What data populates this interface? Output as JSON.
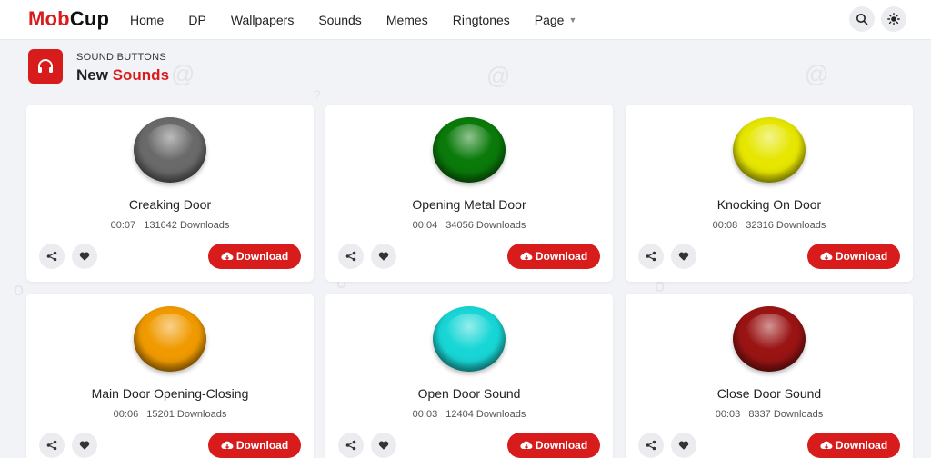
{
  "brand": {
    "part1": "Mob",
    "part2": "Cup"
  },
  "nav": {
    "items": [
      {
        "label": "Home"
      },
      {
        "label": "DP"
      },
      {
        "label": "Wallpapers"
      },
      {
        "label": "Sounds"
      },
      {
        "label": "Memes"
      },
      {
        "label": "Ringtones"
      },
      {
        "label": "Page"
      }
    ],
    "search_icon": "search-icon",
    "theme_icon": "sun-icon"
  },
  "section": {
    "subtitle": "SOUND BUTTONS",
    "title_plain": "New ",
    "title_highlight": "Sounds",
    "icon": "headphones-icon"
  },
  "cards": [
    {
      "title": "Creaking Door",
      "duration": "00:07",
      "downloads": "131642 Downloads",
      "color": "#6a6a6a",
      "download_label": "Download"
    },
    {
      "title": "Opening Metal Door",
      "duration": "00:04",
      "downloads": "34056 Downloads",
      "color": "#0a7a0a",
      "download_label": "Download"
    },
    {
      "title": "Knocking On Door",
      "duration": "00:08",
      "downloads": "32316 Downloads",
      "color": "#e6e600",
      "download_label": "Download"
    },
    {
      "title": "Main Door Opening-Closing",
      "duration": "00:06",
      "downloads": "15201 Downloads",
      "color": "#f09a00",
      "download_label": "Download"
    },
    {
      "title": "Open Door Sound",
      "duration": "00:03",
      "downloads": "12404 Downloads",
      "color": "#19d6d6",
      "download_label": "Download"
    },
    {
      "title": "Close Door Sound",
      "duration": "00:03",
      "downloads": "8337 Downloads",
      "color": "#9a1414",
      "download_label": "Download"
    }
  ],
  "colors": {
    "accent": "#d81b1b",
    "background": "#f2f3f7"
  }
}
